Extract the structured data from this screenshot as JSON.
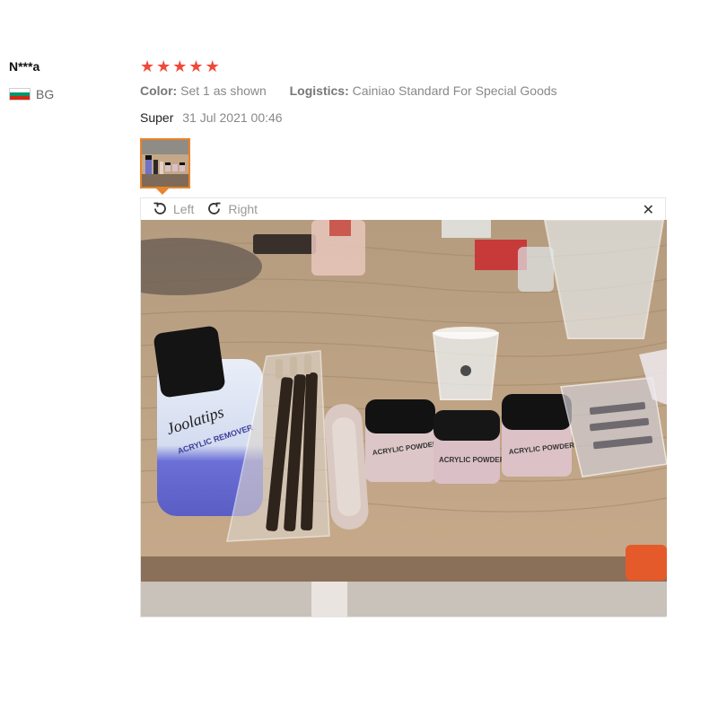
{
  "reviewer": {
    "name": "N***a",
    "country": "BG",
    "flag_colors": [
      "#ffffff",
      "#00966e",
      "#d62612"
    ]
  },
  "rating": {
    "stars": 5,
    "max": 5,
    "color": "#f0493a"
  },
  "attributes": {
    "color_label": "Color:",
    "color_value": "Set 1 as shown",
    "logistics_label": "Logistics:",
    "logistics_value": "Cainiao Standard For Special Goods"
  },
  "review": {
    "text": "Super",
    "date": "31 Jul 2021 00:46"
  },
  "thumbnail": {
    "selected": true,
    "border_color": "#e8842c"
  },
  "viewer": {
    "rotate_left_label": "Left",
    "rotate_right_label": "Right",
    "close_glyph": "✕",
    "photo_labels": {
      "brand": "Joolatips",
      "remover": "ACRYLIC REMOVER",
      "powder": "ACRYLIC POWDER"
    }
  }
}
